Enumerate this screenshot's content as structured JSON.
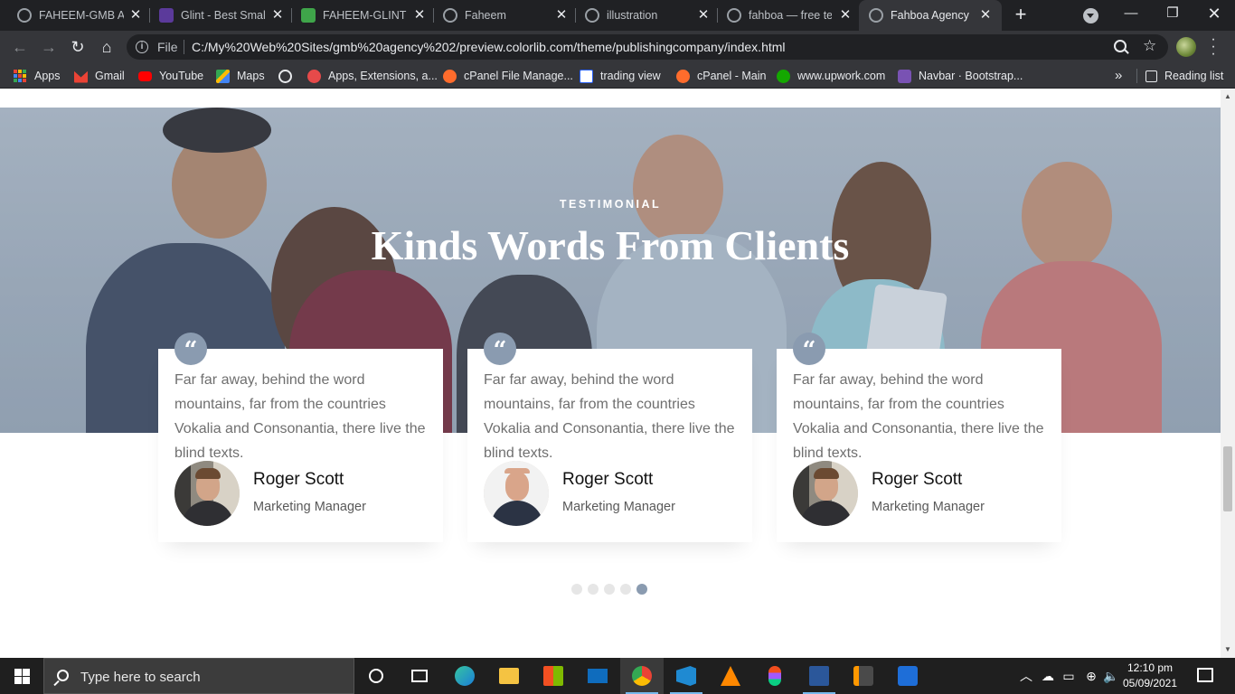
{
  "browser": {
    "tabs": [
      {
        "title": "FAHEEM-GMB AG",
        "favicon_color": "globe",
        "active": false
      },
      {
        "title": "Glint - Best Small",
        "favicon_color": "#5b3a9b",
        "active": false
      },
      {
        "title": "FAHEEM-GLINT",
        "favicon_color": "#3fa54a",
        "active": false
      },
      {
        "title": "Faheem",
        "favicon_color": "globe",
        "active": false
      },
      {
        "title": "illustration",
        "favicon_color": "globe",
        "active": false
      },
      {
        "title": "fahboa — free te",
        "favicon_color": "globe",
        "active": false
      },
      {
        "title": "Fahboa Agency",
        "favicon_color": "globe",
        "active": true
      }
    ],
    "address": {
      "scheme": "File",
      "url": "C:/My%20Web%20Sites/gmb%20agency%202/preview.colorlib.com/theme/publishingcompany/index.html"
    },
    "bookmarks": [
      {
        "label": "Apps",
        "icon": "apps-grid-icon"
      },
      {
        "label": "Gmail",
        "icon": "gmail-icon",
        "color": "#ea4335"
      },
      {
        "label": "YouTube",
        "icon": "youtube-icon",
        "color": "#ff0000"
      },
      {
        "label": "Maps",
        "icon": "maps-icon",
        "color": "#34a853"
      },
      {
        "label": "",
        "icon": "globe-icon"
      },
      {
        "label": "Apps, Extensions, a...",
        "icon": "extensions-icon",
        "color": "#e64a4a"
      },
      {
        "label": "cPanel File Manage...",
        "icon": "cpanel-icon",
        "color": "#ff6c2c"
      },
      {
        "label": "trading view",
        "icon": "tradingview-icon",
        "color": "#2962ff"
      },
      {
        "label": "cPanel - Main",
        "icon": "cpanel-icon",
        "color": "#ff6c2c"
      },
      {
        "label": "www.upwork.com",
        "icon": "upwork-icon",
        "color": "#14a800"
      },
      {
        "label": "Navbar · Bootstrap...",
        "icon": "bootstrap-icon",
        "color": "#7952b3"
      }
    ],
    "more": "»",
    "reading_list": "Reading list"
  },
  "page": {
    "subheading": "TESTIMONIAL",
    "heading": "Kinds Words From Clients",
    "accent_color": "#8a9bb0",
    "testimonials": [
      {
        "text": "Far far away, behind the word mountains, far from the countries Vokalia and Consonantia, there live the blind texts.",
        "name": "Roger Scott",
        "position": "Marketing Manager"
      },
      {
        "text": "Far far away, behind the word mountains, far from the countries Vokalia and Consonantia, there live the blind texts.",
        "name": "Roger Scott",
        "position": "Marketing Manager"
      },
      {
        "text": "Far far away, behind the word mountains, far from the countries Vokalia and Consonantia, there live the blind texts.",
        "name": "Roger Scott",
        "position": "Marketing Manager"
      }
    ],
    "pagination": {
      "count": 5,
      "active_index": 4
    }
  },
  "taskbar": {
    "search_placeholder": "Type here to search",
    "time": "12:10 pm",
    "date": "05/09/2021"
  }
}
